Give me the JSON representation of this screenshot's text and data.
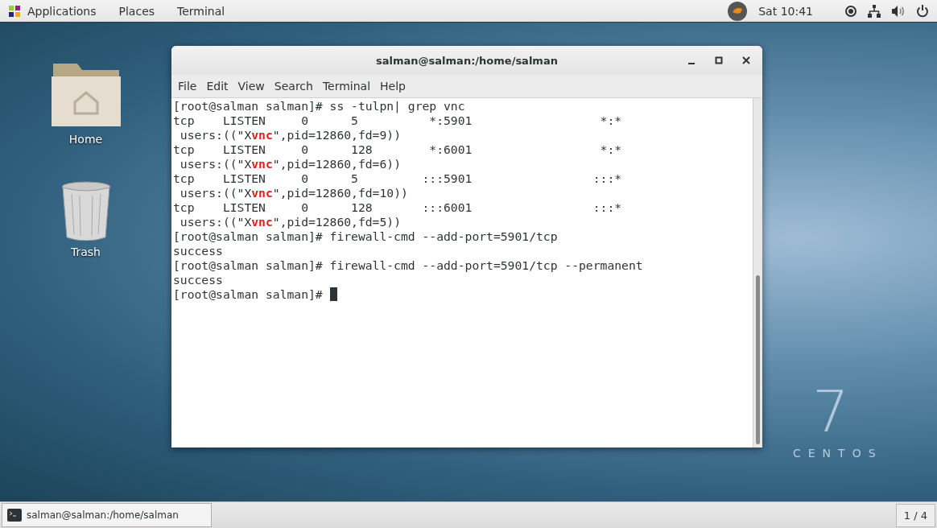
{
  "top_bar": {
    "menus": [
      "Applications",
      "Places",
      "Terminal"
    ],
    "clock": "Sat 10:41"
  },
  "desktop_icons": [
    {
      "label": "Home",
      "kind": "folder"
    },
    {
      "label": "Trash",
      "kind": "trash"
    }
  ],
  "terminal": {
    "title": "salman@salman:/home/salman",
    "menu": [
      "File",
      "Edit",
      "View",
      "Search",
      "Terminal",
      "Help"
    ],
    "lines": [
      [
        {
          "text": "[root@salman salman]# ss -tulpn| grep vnc",
          "highlight": false
        }
      ],
      [
        {
          "text": "tcp    LISTEN     0      5          *:5901                  *:*",
          "highlight": false
        }
      ],
      [
        {
          "text": " users:((\"X",
          "highlight": false
        },
        {
          "text": "vnc",
          "highlight": true
        },
        {
          "text": "\",pid=12860,fd=9))",
          "highlight": false
        }
      ],
      [
        {
          "text": "tcp    LISTEN     0      128        *:6001                  *:*",
          "highlight": false
        }
      ],
      [
        {
          "text": " users:((\"X",
          "highlight": false
        },
        {
          "text": "vnc",
          "highlight": true
        },
        {
          "text": "\",pid=12860,fd=6))",
          "highlight": false
        }
      ],
      [
        {
          "text": "tcp    LISTEN     0      5         :::5901                 :::*",
          "highlight": false
        }
      ],
      [
        {
          "text": " users:((\"X",
          "highlight": false
        },
        {
          "text": "vnc",
          "highlight": true
        },
        {
          "text": "\",pid=12860,fd=10))",
          "highlight": false
        }
      ],
      [
        {
          "text": "tcp    LISTEN     0      128       :::6001                 :::*",
          "highlight": false
        }
      ],
      [
        {
          "text": " users:((\"X",
          "highlight": false
        },
        {
          "text": "vnc",
          "highlight": true
        },
        {
          "text": "\",pid=12860,fd=5))",
          "highlight": false
        }
      ],
      [
        {
          "text": "[root@salman salman]# firewall-cmd --add-port=5901/tcp",
          "highlight": false
        }
      ],
      [
        {
          "text": "success",
          "highlight": false
        }
      ],
      [
        {
          "text": "[root@salman salman]# firewall-cmd --add-port=5901/tcp --permanent",
          "highlight": false
        }
      ],
      [
        {
          "text": "success",
          "highlight": false
        }
      ],
      [
        {
          "text": "[root@salman salman]# ",
          "highlight": false
        }
      ]
    ]
  },
  "wallpaper_logo": {
    "number": "7",
    "text": "CENTOS"
  },
  "taskbar": {
    "windows": [
      {
        "label": "salman@salman:/home/salman",
        "selected": true
      }
    ],
    "workspace": "1 / 4"
  }
}
